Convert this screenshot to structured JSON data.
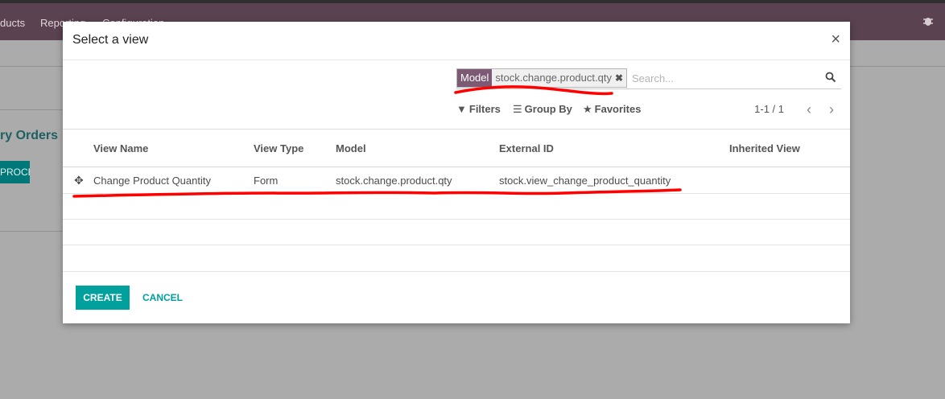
{
  "app": {
    "menu": [
      "ducts",
      "Reporting",
      "Configuration"
    ],
    "background_title": "ry Orders",
    "background_button": "PROCESS"
  },
  "dialog": {
    "title": "Select a view",
    "search": {
      "facet_label": "Model",
      "facet_value": "stock.change.product.qty",
      "placeholder": "Search..."
    },
    "filters": {
      "filters": "Filters",
      "group_by": "Group By",
      "favorites": "Favorites"
    },
    "pager": {
      "text": "1-1 / 1"
    },
    "table": {
      "columns": [
        "View Name",
        "View Type",
        "Model",
        "External ID",
        "Inherited View"
      ],
      "rows": [
        {
          "view_name": "Change Product Quantity",
          "view_type": "Form",
          "model": "stock.change.product.qty",
          "external_id": "stock.view_change_product_quantity",
          "inherited_view": ""
        }
      ]
    },
    "footer": {
      "create": "CREATE",
      "cancel": "CANCEL"
    }
  },
  "colors": {
    "accent": "#00a09d",
    "facet": "#7c5a74",
    "navbar": "#5a4250",
    "annotation": "#ff0000"
  }
}
